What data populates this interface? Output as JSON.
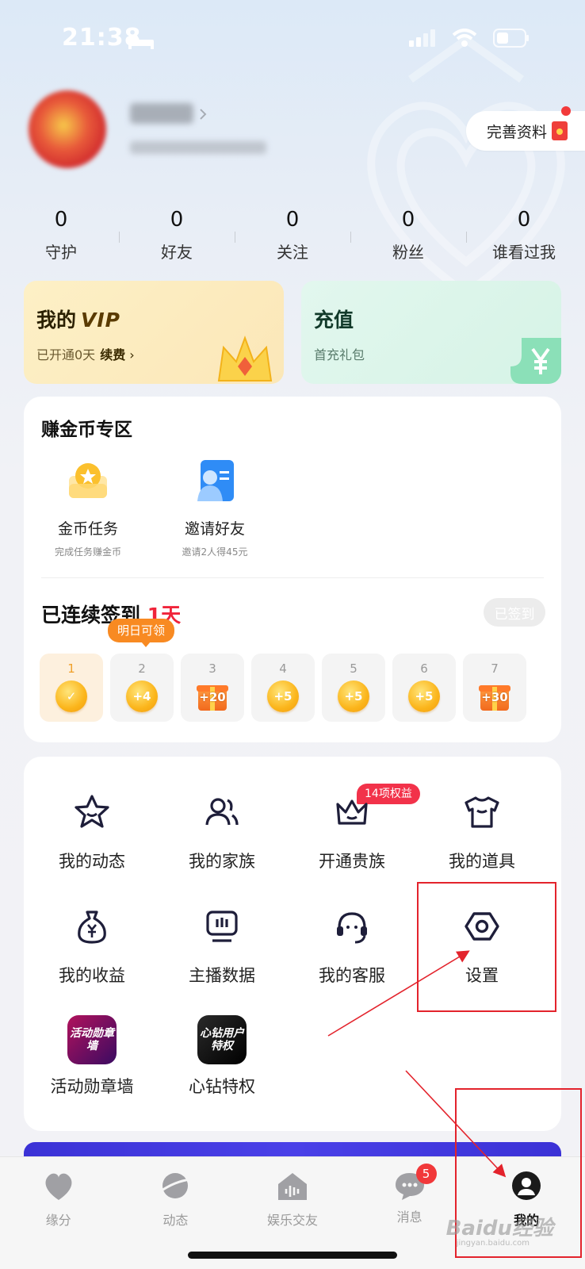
{
  "status_bar": {
    "time": "21:38"
  },
  "profile": {
    "complete_label": "完善资料"
  },
  "stats": [
    {
      "value": "0",
      "label": "守护"
    },
    {
      "value": "0",
      "label": "好友"
    },
    {
      "value": "0",
      "label": "关注"
    },
    {
      "value": "0",
      "label": "粉丝"
    },
    {
      "value": "0",
      "label": "谁看过我"
    }
  ],
  "vip_card": {
    "title": "我的",
    "vip_text": "VIP",
    "status": "已开通0天",
    "renew": "续费"
  },
  "recharge_card": {
    "title": "充值",
    "subtitle": "首充礼包"
  },
  "earn": {
    "title": "赚金币专区",
    "items": [
      {
        "title": "金币任务",
        "subtitle": "完成任务赚金币"
      },
      {
        "title": "邀请好友",
        "subtitle": "邀请2人得45元"
      }
    ]
  },
  "signin": {
    "prefix": "已连续签到",
    "days": "1天",
    "button": "已签到",
    "tomorrow_tag": "明日可领",
    "day_items": [
      {
        "n": "1",
        "reward": "✓"
      },
      {
        "n": "2",
        "reward": "+4"
      },
      {
        "n": "3",
        "reward": "+20"
      },
      {
        "n": "4",
        "reward": "+5"
      },
      {
        "n": "5",
        "reward": "+5"
      },
      {
        "n": "6",
        "reward": "+5"
      },
      {
        "n": "7",
        "reward": "+30"
      }
    ]
  },
  "menu": {
    "items": [
      {
        "label": "我的动态",
        "icon": "star-face-icon"
      },
      {
        "label": "我的家族",
        "icon": "users-icon"
      },
      {
        "label": "开通贵族",
        "icon": "crown-icon"
      },
      {
        "label": "我的道具",
        "icon": "shirt-icon"
      },
      {
        "label": "我的收益",
        "icon": "money-bag-icon"
      },
      {
        "label": "主播数据",
        "icon": "monitor-icon"
      },
      {
        "label": "我的客服",
        "icon": "headset-icon"
      },
      {
        "label": "设置",
        "icon": "settings-icon"
      },
      {
        "label": "活动勋章墙",
        "icon": "activity-medal-icon",
        "icon_text": "活动勋章墙"
      },
      {
        "label": "心钻特权",
        "icon": "diamond-privilege-icon",
        "icon_text": "心钻用户特权"
      }
    ],
    "noble_badge": "14项权益"
  },
  "bottom_nav": {
    "tabs": [
      {
        "label": "缘分",
        "icon": "heart-icon"
      },
      {
        "label": "动态",
        "icon": "planet-icon"
      },
      {
        "label": "娱乐交友",
        "icon": "house-audio-icon"
      },
      {
        "label": "消息",
        "icon": "chat-icon"
      },
      {
        "label": "我的",
        "icon": "profile-icon"
      }
    ],
    "message_badge": "5",
    "active": "我的"
  },
  "watermark": {
    "text": "Baidu经验",
    "sub": "jingyan.baidu.com"
  },
  "colors": {
    "accent_red": "#f0243a",
    "coin": "#fbb51b",
    "annotation": "#e3232c"
  }
}
